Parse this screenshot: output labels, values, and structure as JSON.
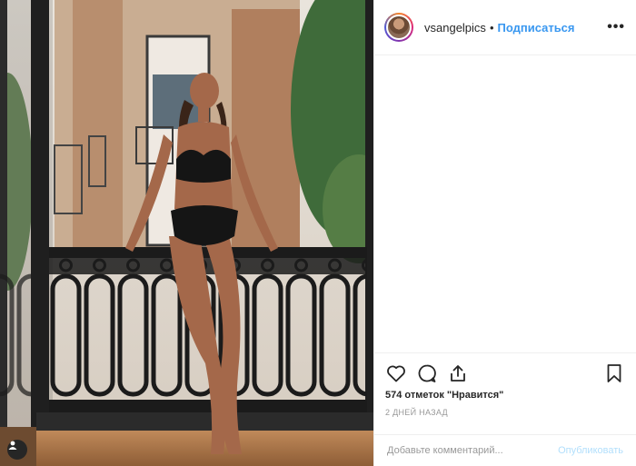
{
  "post": {
    "username": "vsangelpics",
    "separator": "•",
    "follow_label": "Подписаться",
    "more_label": "•••",
    "likes": "574 отметок \"Нравится\"",
    "time": "2 дней назад",
    "comment_placeholder": "Добавьте комментарий...",
    "publish_label": "Опубликовать"
  },
  "icons": {
    "like": "heart-icon",
    "comment": "speech-bubble-icon",
    "share": "share-icon",
    "save": "bookmark-icon",
    "user_tag": "user-tag-icon",
    "more": "more-options-icon"
  },
  "colors": {
    "accent": "#3897f0",
    "border": "#efefef",
    "muted": "#999999",
    "disabled_link": "#b2dffc"
  }
}
